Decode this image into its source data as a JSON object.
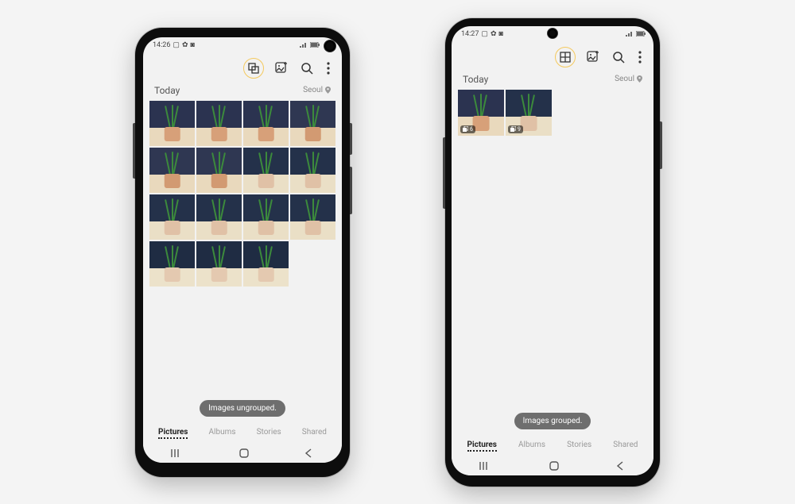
{
  "phoneA": {
    "status": {
      "time": "14:26",
      "location": "Seoul"
    },
    "header": {
      "day_label": "Today"
    },
    "toolbar": {
      "group_icon": "ungroup-icon",
      "create_icon": "create-icon",
      "search_icon": "search-icon",
      "more_icon": "more-icon"
    },
    "toast": "Images ungrouped.",
    "tabs": [
      "Pictures",
      "Albums",
      "Stories",
      "Shared"
    ],
    "active_tab_index": 0,
    "thumb_variants": [
      "v1",
      "v1",
      "v1",
      "v2",
      "v2",
      "v2",
      "v3",
      "v3",
      "v3",
      "v3",
      "v3",
      "v3",
      "v4",
      "v4",
      "v4"
    ]
  },
  "phoneB": {
    "status": {
      "time": "14:27",
      "location": "Seoul"
    },
    "header": {
      "day_label": "Today"
    },
    "toolbar": {
      "group_icon": "group-grid-icon",
      "create_icon": "create-icon",
      "search_icon": "search-icon",
      "more_icon": "more-icon"
    },
    "toast": "Images grouped.",
    "tabs": [
      "Pictures",
      "Albums",
      "Stories",
      "Shared"
    ],
    "active_tab_index": 0,
    "groups": [
      {
        "variant": "v1",
        "count": 6
      },
      {
        "variant": "v3",
        "count": 9
      }
    ]
  }
}
